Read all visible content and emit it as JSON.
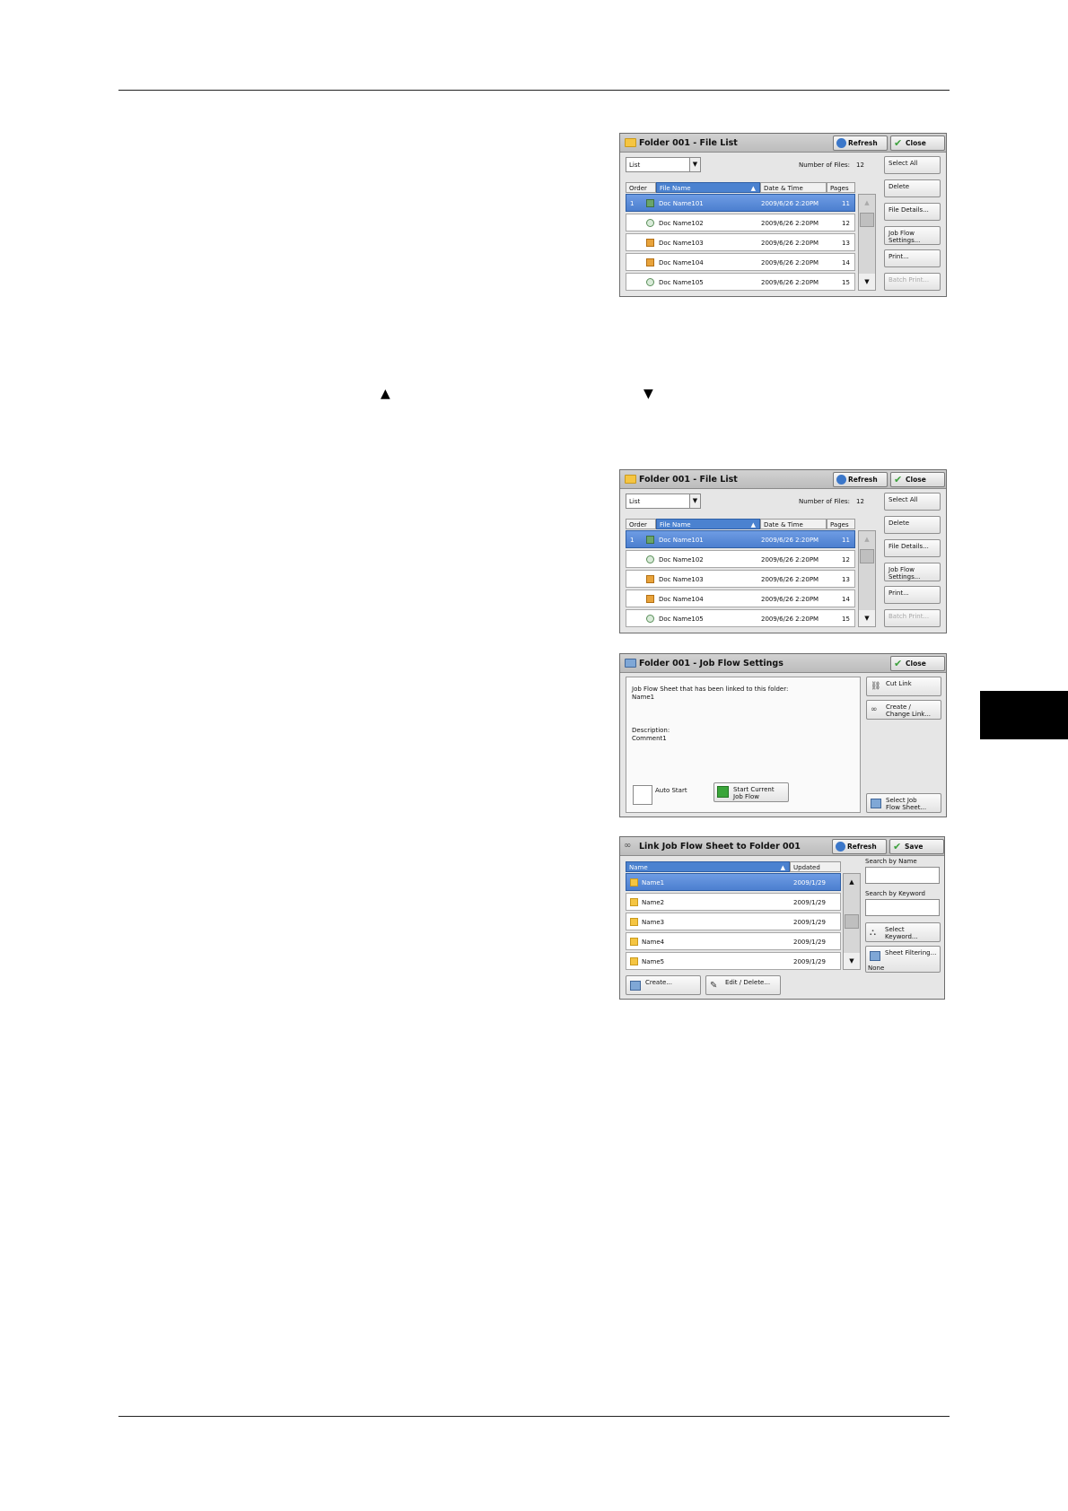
{
  "panel1": {
    "title": "Folder 001 - File List",
    "refresh": "Refresh",
    "close": "Close",
    "view_select": "List",
    "number_of_files_label": "Number of Files:",
    "number_of_files": "12",
    "headers": {
      "order": "Order",
      "file_name": "File Name",
      "date_time": "Date & Time",
      "pages": "Pages"
    },
    "rows": [
      {
        "order": "1",
        "name": "Doc Name101",
        "date": "2009/6/26 2:20PM",
        "pages": "11",
        "icon": "scan-icon"
      },
      {
        "order": "",
        "name": "Doc Name102",
        "date": "2009/6/26 2:20PM",
        "pages": "12",
        "icon": "fax-icon"
      },
      {
        "order": "",
        "name": "Doc Name103",
        "date": "2009/6/26 2:20PM",
        "pages": "13",
        "icon": "document-icon"
      },
      {
        "order": "",
        "name": "Doc Name104",
        "date": "2009/6/26 2:20PM",
        "pages": "14",
        "icon": "document-icon"
      },
      {
        "order": "",
        "name": "Doc Name105",
        "date": "2009/6/26 2:20PM",
        "pages": "15",
        "icon": "fax-icon"
      }
    ],
    "buttons": {
      "select_all": "Select All",
      "delete": "Delete",
      "file_details": "File Details...",
      "job_flow_1": "Job Flow",
      "job_flow_2": "Settings...",
      "print": "Print...",
      "batch_print": "Batch Print..."
    }
  },
  "instruction": {
    "up_arrow": "▲",
    "down_arrow": "▼"
  },
  "panel2": {
    "title": "Folder 001 - File List",
    "refresh": "Refresh",
    "close": "Close",
    "view_select": "List",
    "number_of_files_label": "Number of Files:",
    "number_of_files": "12",
    "headers": {
      "order": "Order",
      "file_name": "File Name",
      "date_time": "Date & Time",
      "pages": "Pages"
    },
    "rows": [
      {
        "order": "1",
        "name": "Doc Name101",
        "date": "2009/6/26 2:20PM",
        "pages": "11",
        "icon": "scan-icon"
      },
      {
        "order": "",
        "name": "Doc Name102",
        "date": "2009/6/26 2:20PM",
        "pages": "12",
        "icon": "fax-icon"
      },
      {
        "order": "",
        "name": "Doc Name103",
        "date": "2009/6/26 2:20PM",
        "pages": "13",
        "icon": "document-icon"
      },
      {
        "order": "",
        "name": "Doc Name104",
        "date": "2009/6/26 2:20PM",
        "pages": "14",
        "icon": "document-icon"
      },
      {
        "order": "",
        "name": "Doc Name105",
        "date": "2009/6/26 2:20PM",
        "pages": "15",
        "icon": "fax-icon"
      }
    ],
    "buttons": {
      "select_all": "Select All",
      "delete": "Delete",
      "file_details": "File Details...",
      "job_flow_1": "Job Flow",
      "job_flow_2": "Settings...",
      "print": "Print...",
      "batch_print": "Batch Print..."
    }
  },
  "panel3": {
    "title": "Folder 001 - Job Flow Settings",
    "close": "Close",
    "linked_label": "Job Flow Sheet that has been linked to this folder:",
    "linked_value": "Name1",
    "description_label": "Description:",
    "description_value": "Comment1",
    "auto_start": "Auto Start",
    "start_current_1": "Start Current",
    "start_current_2": "Job Flow",
    "cut_link": "Cut Link",
    "create_change_1": "Create /",
    "create_change_2": "Change Link...",
    "select_job_1": "Select Job",
    "select_job_2": "Flow Sheet..."
  },
  "panel4": {
    "title": "Link Job Flow Sheet to Folder 001",
    "refresh": "Refresh",
    "save": "Save",
    "headers": {
      "name": "Name",
      "updated": "Updated"
    },
    "rows": [
      {
        "name": "Name1",
        "updated": "2009/1/29"
      },
      {
        "name": "Name2",
        "updated": "2009/1/29"
      },
      {
        "name": "Name3",
        "updated": "2009/1/29"
      },
      {
        "name": "Name4",
        "updated": "2009/1/29"
      },
      {
        "name": "Name5",
        "updated": "2009/1/29"
      }
    ],
    "search_by_name": "Search by Name",
    "search_by_keyword": "Search by Keyword",
    "select_keyword_1": "Select",
    "select_keyword_2": "Keyword...",
    "sheet_filtering": "Sheet Filtering...",
    "filter_value": "None",
    "create": "Create...",
    "edit_delete": "Edit / Delete..."
  }
}
